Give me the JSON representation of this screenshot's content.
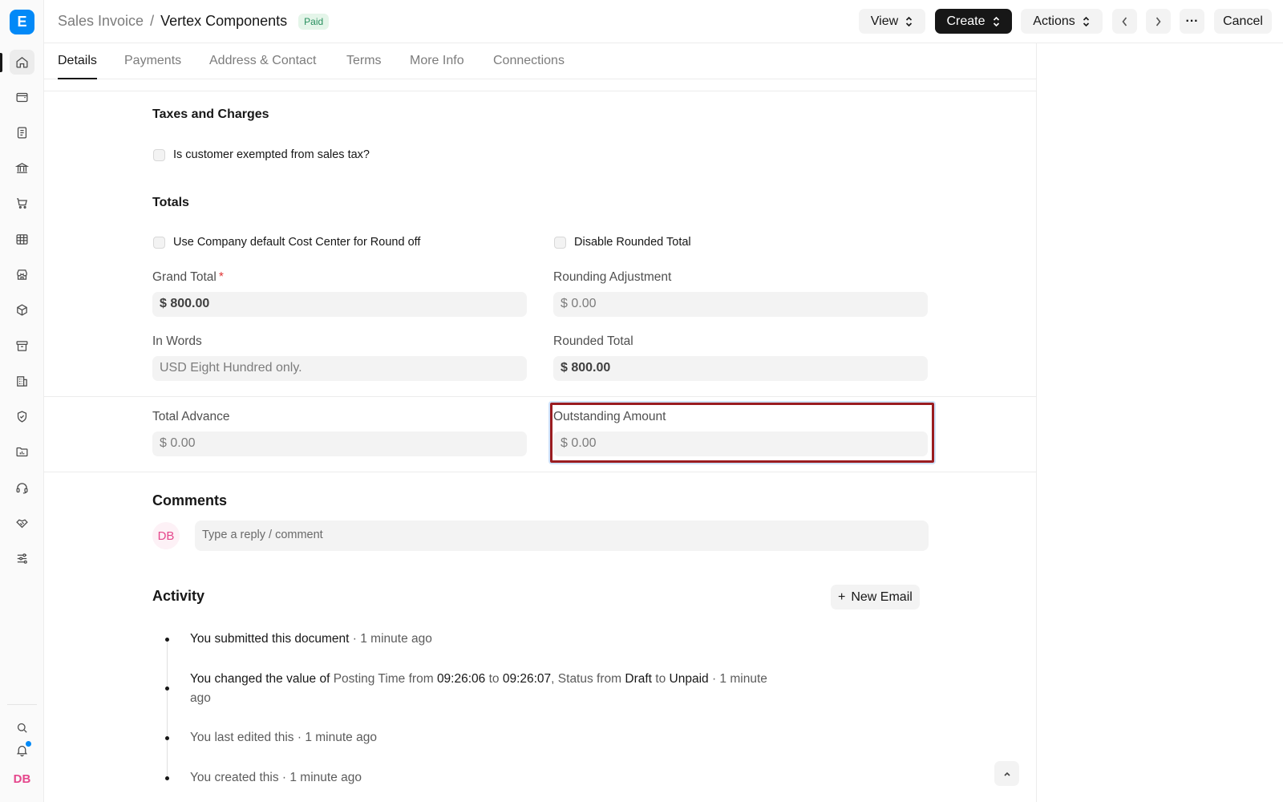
{
  "app": {
    "logo_letter": "E"
  },
  "breadcrumb": {
    "doctype": "Sales Invoice",
    "separator": "/",
    "title": "Vertex Components",
    "status": "Paid"
  },
  "header_buttons": {
    "view": "View",
    "create": "Create",
    "actions": "Actions",
    "more": "···",
    "cancel": "Cancel"
  },
  "tabs": [
    "Details",
    "Payments",
    "Address & Contact",
    "Terms",
    "More Info",
    "Connections"
  ],
  "taxes": {
    "title": "Taxes and Charges",
    "exempt_label": "Is customer exempted from sales tax?"
  },
  "totals": {
    "title": "Totals",
    "round_off_label": "Use Company default Cost Center for Round off",
    "disable_rounded_label": "Disable Rounded Total",
    "grand_total_label": "Grand Total",
    "grand_total_required": "*",
    "grand_total": "$ 800.00",
    "rounding_adjustment_label": "Rounding Adjustment",
    "rounding_adjustment": "$ 0.00",
    "in_words_label": "In Words",
    "in_words": "USD Eight Hundred only.",
    "rounded_total_label": "Rounded Total",
    "rounded_total": "$ 800.00"
  },
  "advance": {
    "total_advance_label": "Total Advance",
    "total_advance": "$ 0.00",
    "outstanding_label": "Outstanding Amount",
    "outstanding": "$ 0.00"
  },
  "comments": {
    "title": "Comments",
    "avatar_initials": "DB",
    "placeholder": "Type a reply / comment"
  },
  "activity": {
    "title": "Activity",
    "new_email": "New Email",
    "items": [
      {
        "actor_action": "You submitted this document",
        "time": " · 1 minute ago"
      },
      {
        "prefix": "You changed the value of ",
        "field1": "Posting Time",
        "from1_word": " from ",
        "from1": "09:26:06",
        "to1_word": " to ",
        "to1": "09:26:07",
        "sep": ", ",
        "field2": "Status",
        "from2_word": " from ",
        "from2": "Draft",
        "to2_word": " to ",
        "to2": "Unpaid",
        "time": " · 1 minute ago"
      },
      {
        "text": "You last edited this",
        "time": " · 1 minute ago"
      },
      {
        "text": "You created this",
        "time": " · 1 minute ago"
      }
    ]
  },
  "user": {
    "initials": "DB"
  },
  "colors": {
    "accent": "#0289f7",
    "paid_badge_bg": "#e4f5e9",
    "paid_badge_text": "#278f5e",
    "highlight_border": "#9a1c20",
    "avatar_pink": "#e5478c"
  },
  "icons": {
    "sidebar": [
      "home-icon",
      "wallet-icon",
      "receipt-icon",
      "bank-icon",
      "cart-icon",
      "table-icon",
      "store-icon",
      "package-icon",
      "archive-icon",
      "building-icon",
      "shield-icon",
      "folder-icon",
      "headset-icon",
      "handshake-icon",
      "sliders-icon",
      "search-icon",
      "bell-icon"
    ]
  }
}
